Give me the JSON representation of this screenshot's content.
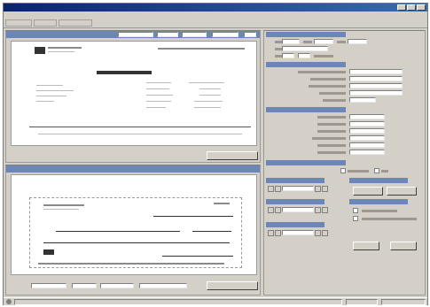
{
  "window": {
    "title": "",
    "menu": [],
    "toolbar": []
  },
  "remittance": {
    "header": "",
    "statement_title": "",
    "show_button": ""
  },
  "cheque": {
    "header": "",
    "show_button": ""
  },
  "right_panel": {
    "sections": [],
    "buttons": []
  },
  "status": []
}
